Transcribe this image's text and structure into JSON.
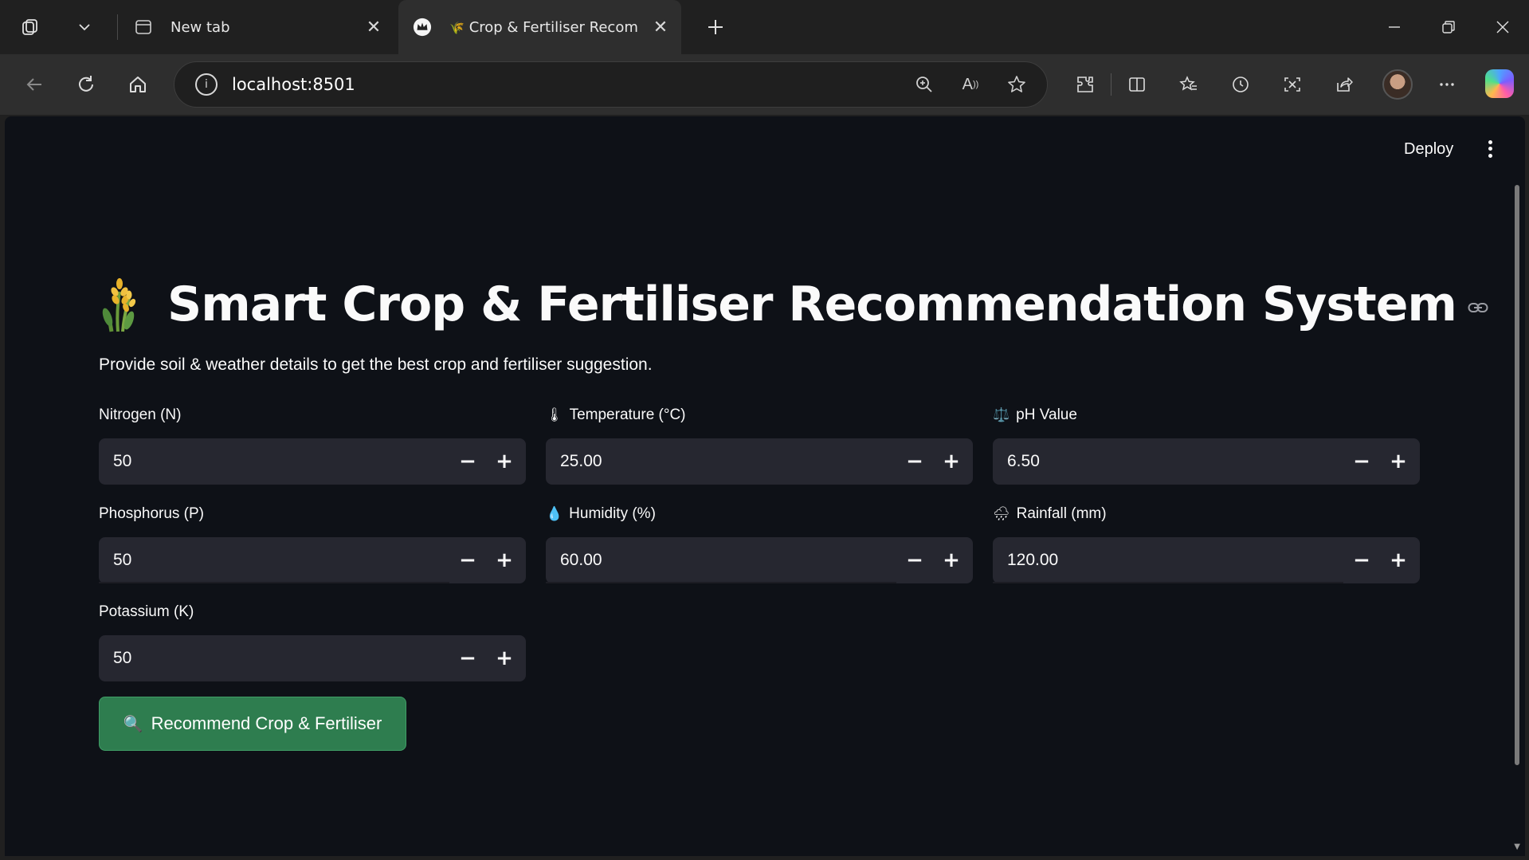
{
  "browser": {
    "tabs": [
      {
        "label": "New tab",
        "icon": "new-tab-page-icon"
      },
      {
        "label": "Crop & Fertiliser Recom",
        "icon": "crop-favicon"
      }
    ],
    "address": {
      "url": "localhost:8501"
    }
  },
  "app": {
    "deploy_label": "Deploy",
    "title": "Smart Crop & Fertiliser Recommendation System",
    "subtitle": "Provide soil & weather details to get the best crop and fertiliser suggestion.",
    "fields": {
      "nitrogen": {
        "label": "Nitrogen (N)",
        "emoji": "",
        "value": "50"
      },
      "phosphorus": {
        "label": "Phosphorus (P)",
        "emoji": "",
        "value": "50"
      },
      "potassium": {
        "label": "Potassium (K)",
        "emoji": "",
        "value": "50"
      },
      "temperature": {
        "label": "Temperature (°C)",
        "emoji": "🌡",
        "value": "25.00"
      },
      "humidity": {
        "label": "Humidity (%)",
        "emoji": "💧",
        "value": "60.00"
      },
      "ph": {
        "label": "pH Value",
        "emoji": "⚖️",
        "value": "6.50"
      },
      "rainfall": {
        "label": "Rainfall (mm)",
        "emoji": "🌧",
        "value": "120.00"
      }
    },
    "stepper": {
      "minus": "−",
      "plus": "+"
    },
    "recommend_button": {
      "label": "Recommend Crop & Fertiliser",
      "emoji": "🔍"
    }
  },
  "colors": {
    "page_bg": "#0e1117",
    "input_bg": "#262730",
    "button_bg": "#2e7d4f"
  }
}
